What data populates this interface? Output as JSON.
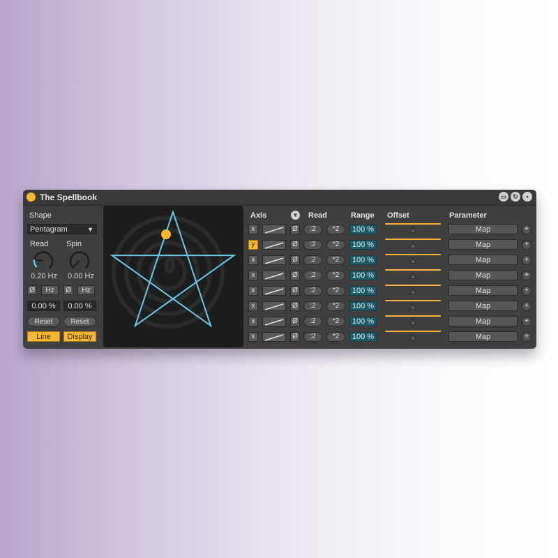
{
  "device": {
    "title": "The Spellbook",
    "titlebar_icons": [
      "monitor-icon",
      "refresh-icon",
      "save-icon"
    ],
    "accent_color": "#f7b733",
    "line_color": "#6cc6e6"
  },
  "left": {
    "shape_label": "Shape",
    "shape_value": "Pentagram",
    "read_label": "Read",
    "spin_label": "Spin",
    "read_value": "0.20 Hz",
    "spin_value": "0.00 Hz",
    "phase_label": "Ø",
    "hz_label": "Hz",
    "read_percent": "0.00 %",
    "spin_percent": "0.00 %",
    "reset_label": "Reset",
    "line_label": "Line",
    "display_label": "Display",
    "read_knob_level": 0.2,
    "spin_knob_level": 0.0
  },
  "display": {
    "shape": "pentagram",
    "cursor_color": "#f7b733"
  },
  "table": {
    "headers": {
      "axis": "Axis",
      "read": "Read",
      "range": "Range",
      "offset": "Offset",
      "parameter": "Parameter"
    },
    "rows": [
      {
        "axis": "x",
        "active": false,
        "phase": "Ø",
        "div": ":2",
        "mul": "*2",
        "range": "100 %",
        "offset": 0.5,
        "map": "Map",
        "plus": "+"
      },
      {
        "axis": "y",
        "active": true,
        "phase": "Ø",
        "div": ":2",
        "mul": "*2",
        "range": "100 %",
        "offset": 0.5,
        "map": "Map",
        "plus": "+"
      },
      {
        "axis": "x",
        "active": false,
        "phase": "Ø",
        "div": ":2",
        "mul": "*2",
        "range": "100 %",
        "offset": 0.5,
        "map": "Map",
        "plus": "+"
      },
      {
        "axis": "x",
        "active": false,
        "phase": "Ø",
        "div": ":2",
        "mul": "*2",
        "range": "100 %",
        "offset": 0.5,
        "map": "Map",
        "plus": "+"
      },
      {
        "axis": "x",
        "active": false,
        "phase": "Ø",
        "div": ":2",
        "mul": "*2",
        "range": "100 %",
        "offset": 0.5,
        "map": "Map",
        "plus": "+"
      },
      {
        "axis": "x",
        "active": false,
        "phase": "Ø",
        "div": ":2",
        "mul": "*2",
        "range": "100 %",
        "offset": 0.5,
        "map": "Map",
        "plus": "+"
      },
      {
        "axis": "x",
        "active": false,
        "phase": "Ø",
        "div": ":2",
        "mul": "*2",
        "range": "100 %",
        "offset": 0.5,
        "map": "Map",
        "plus": "+"
      },
      {
        "axis": "x",
        "active": false,
        "phase": "Ø",
        "div": ":2",
        "mul": "*2",
        "range": "100 %",
        "offset": 0.5,
        "map": "Map",
        "plus": "+"
      }
    ]
  }
}
